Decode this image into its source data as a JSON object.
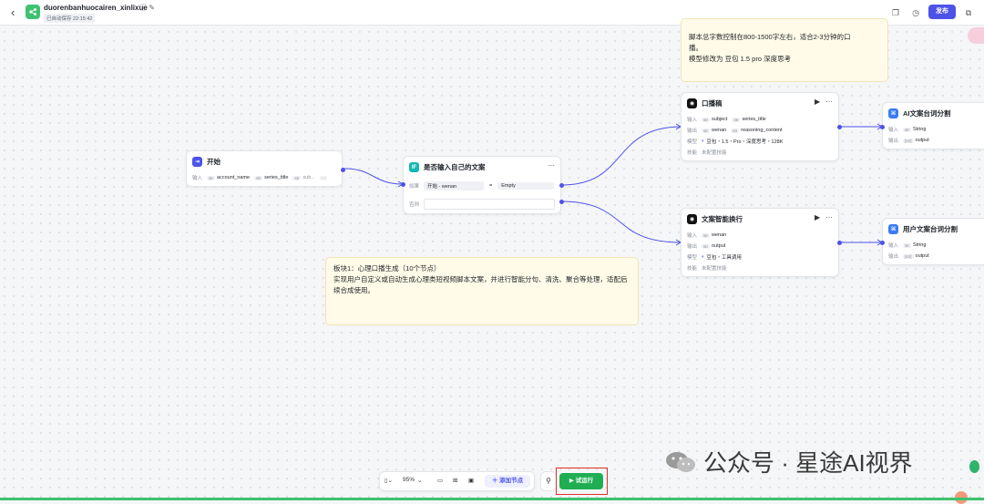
{
  "header": {
    "back_icon": "chevron-left-icon",
    "app_name": "duorenbanhuocairen_xinlixue",
    "saved_status": "已自动保存 22:15:42",
    "publish_label": "发布"
  },
  "nodes": {
    "start": {
      "title": "开始",
      "input_label": "输入",
      "inputs": [
        "account_name",
        "series_title",
        "sub..."
      ]
    },
    "condition": {
      "title": "是否输入自己的文案",
      "if_label": "如果",
      "operand": "开始 - wenan",
      "operator": "=",
      "value": "Empty",
      "else_label": "否则"
    },
    "koubo": {
      "title": "口播稿",
      "input_label": "输入",
      "inputs": [
        "subject",
        "series_title"
      ],
      "output_label": "输出",
      "outputs": [
        "wenan",
        "reasoning_content"
      ],
      "model_label": "模型",
      "model": "豆包・1.5・Pro・深度思考・128K",
      "skill_label": "技能",
      "skill": "未配置技能"
    },
    "ai_split": {
      "title": "AI文案台词分割",
      "input_label": "输入",
      "input": "String",
      "output_label": "输出",
      "output": "output"
    },
    "smart_wrap": {
      "title": "文案智能换行",
      "input_label": "输入",
      "input": "wenan",
      "output_label": "输出",
      "output": "output",
      "model_label": "模型",
      "model": "豆包・工具调用",
      "skill_label": "技能",
      "skill": "未配置技能"
    },
    "user_split": {
      "title": "用户文案台词分割",
      "input_label": "输入",
      "input": "String",
      "output_label": "输出",
      "output": "output"
    }
  },
  "notes": {
    "top_lines": [
      "脚本总字数控制在800-1500字左右，适合2-3分钟的口",
      "播。",
      "模型修改为 豆包 1.5 pro 深度思考"
    ],
    "block_title": "板块1：心理口播生成（10个节点）",
    "block_body": "实现用户自定义或自动生成心理类短视频脚本文案，并进行智能分句、清洗、聚合等处理，适配后续合成使用。"
  },
  "toolbar": {
    "zoom": "95%",
    "add_node_label": "添加节点",
    "run_label": "试运行"
  },
  "watermark": "公众号 · 星途AI视界",
  "colors": {
    "accent": "#4d53e8",
    "run_green": "#1fae52",
    "note_bg": "#fffbe8",
    "highlight": "#e0302a"
  }
}
